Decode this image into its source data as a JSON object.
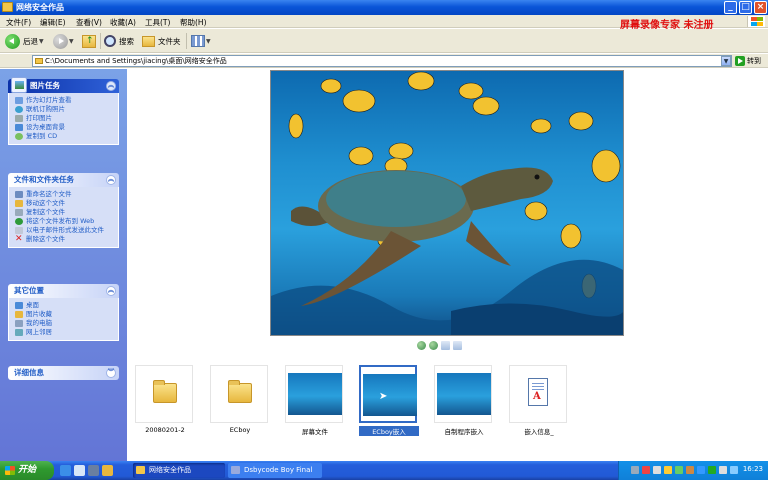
{
  "window": {
    "title": "网络安全作品"
  },
  "watermark": "屏幕录像专家  未注册",
  "menu": [
    "文件(F)",
    "编辑(E)",
    "查看(V)",
    "收藏(A)",
    "工具(T)",
    "帮助(H)"
  ],
  "toolbar": {
    "back": "后退",
    "search": "搜索",
    "folders": "文件夹"
  },
  "address": {
    "path": "C:\\Documents and Settings\\jiacing\\桌面\\网络安全作品",
    "go": "转到"
  },
  "panels": {
    "picture_tasks": {
      "title": "图片任务",
      "items": [
        "作为幻灯片查看",
        "联机订购照片",
        "打印图片",
        "设为桌面背景",
        "复制到 CD"
      ]
    },
    "file_tasks": {
      "title": "文件和文件夹任务",
      "items": [
        "重命名这个文件",
        "移动这个文件",
        "复制这个文件",
        "将这个文件发布到 Web",
        "以电子邮件形式发送此文件",
        "删除这个文件"
      ]
    },
    "other_places": {
      "title": "其它位置",
      "items": [
        "桌面",
        "图片收藏",
        "我的电脑",
        "网上邻居"
      ]
    },
    "details": {
      "title": "详细信息"
    }
  },
  "thumbnails": [
    {
      "label": "20080201-2",
      "kind": "folder"
    },
    {
      "label": "ECboy",
      "kind": "folder"
    },
    {
      "label": "屏幕文件",
      "kind": "image"
    },
    {
      "label": "ECboy嵌入",
      "kind": "image",
      "selected": true
    },
    {
      "label": "自制程序嵌入",
      "kind": "image"
    },
    {
      "label": "嵌入信息_",
      "kind": "document"
    }
  ],
  "taskbar": {
    "start": "开始",
    "tasks": [
      "网络安全作品",
      "Dsbycode Boy Final"
    ],
    "clock": "16:23"
  }
}
